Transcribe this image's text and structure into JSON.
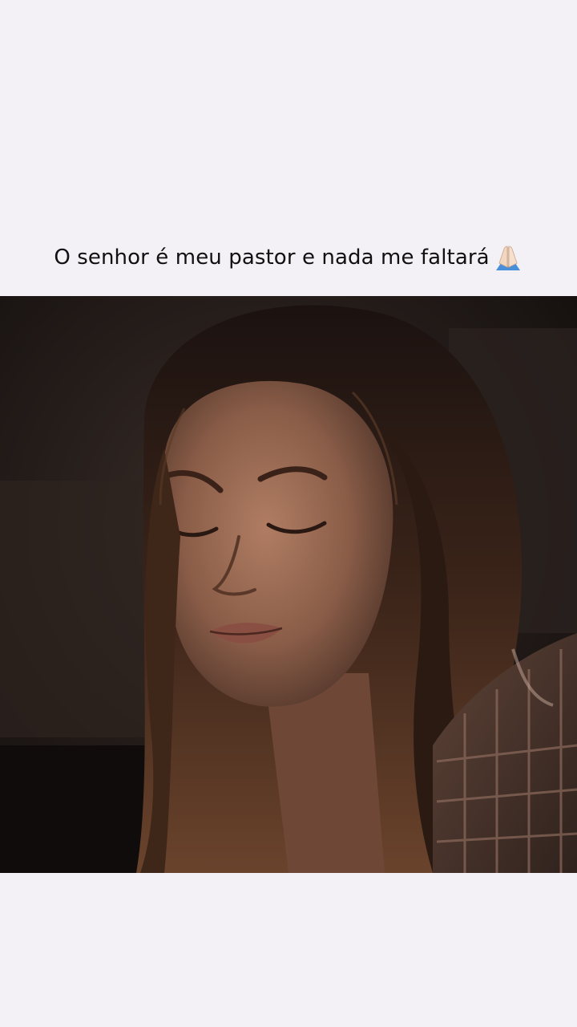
{
  "caption": {
    "text": "O senhor é meu pastor e nada me faltará",
    "emoji_icon": "praying-hands-icon"
  },
  "video": {
    "description_icon": "video-frame"
  },
  "colors": {
    "page_background": "#f3f1f6",
    "caption_text": "#111111",
    "frame_background": "#1c1715"
  }
}
